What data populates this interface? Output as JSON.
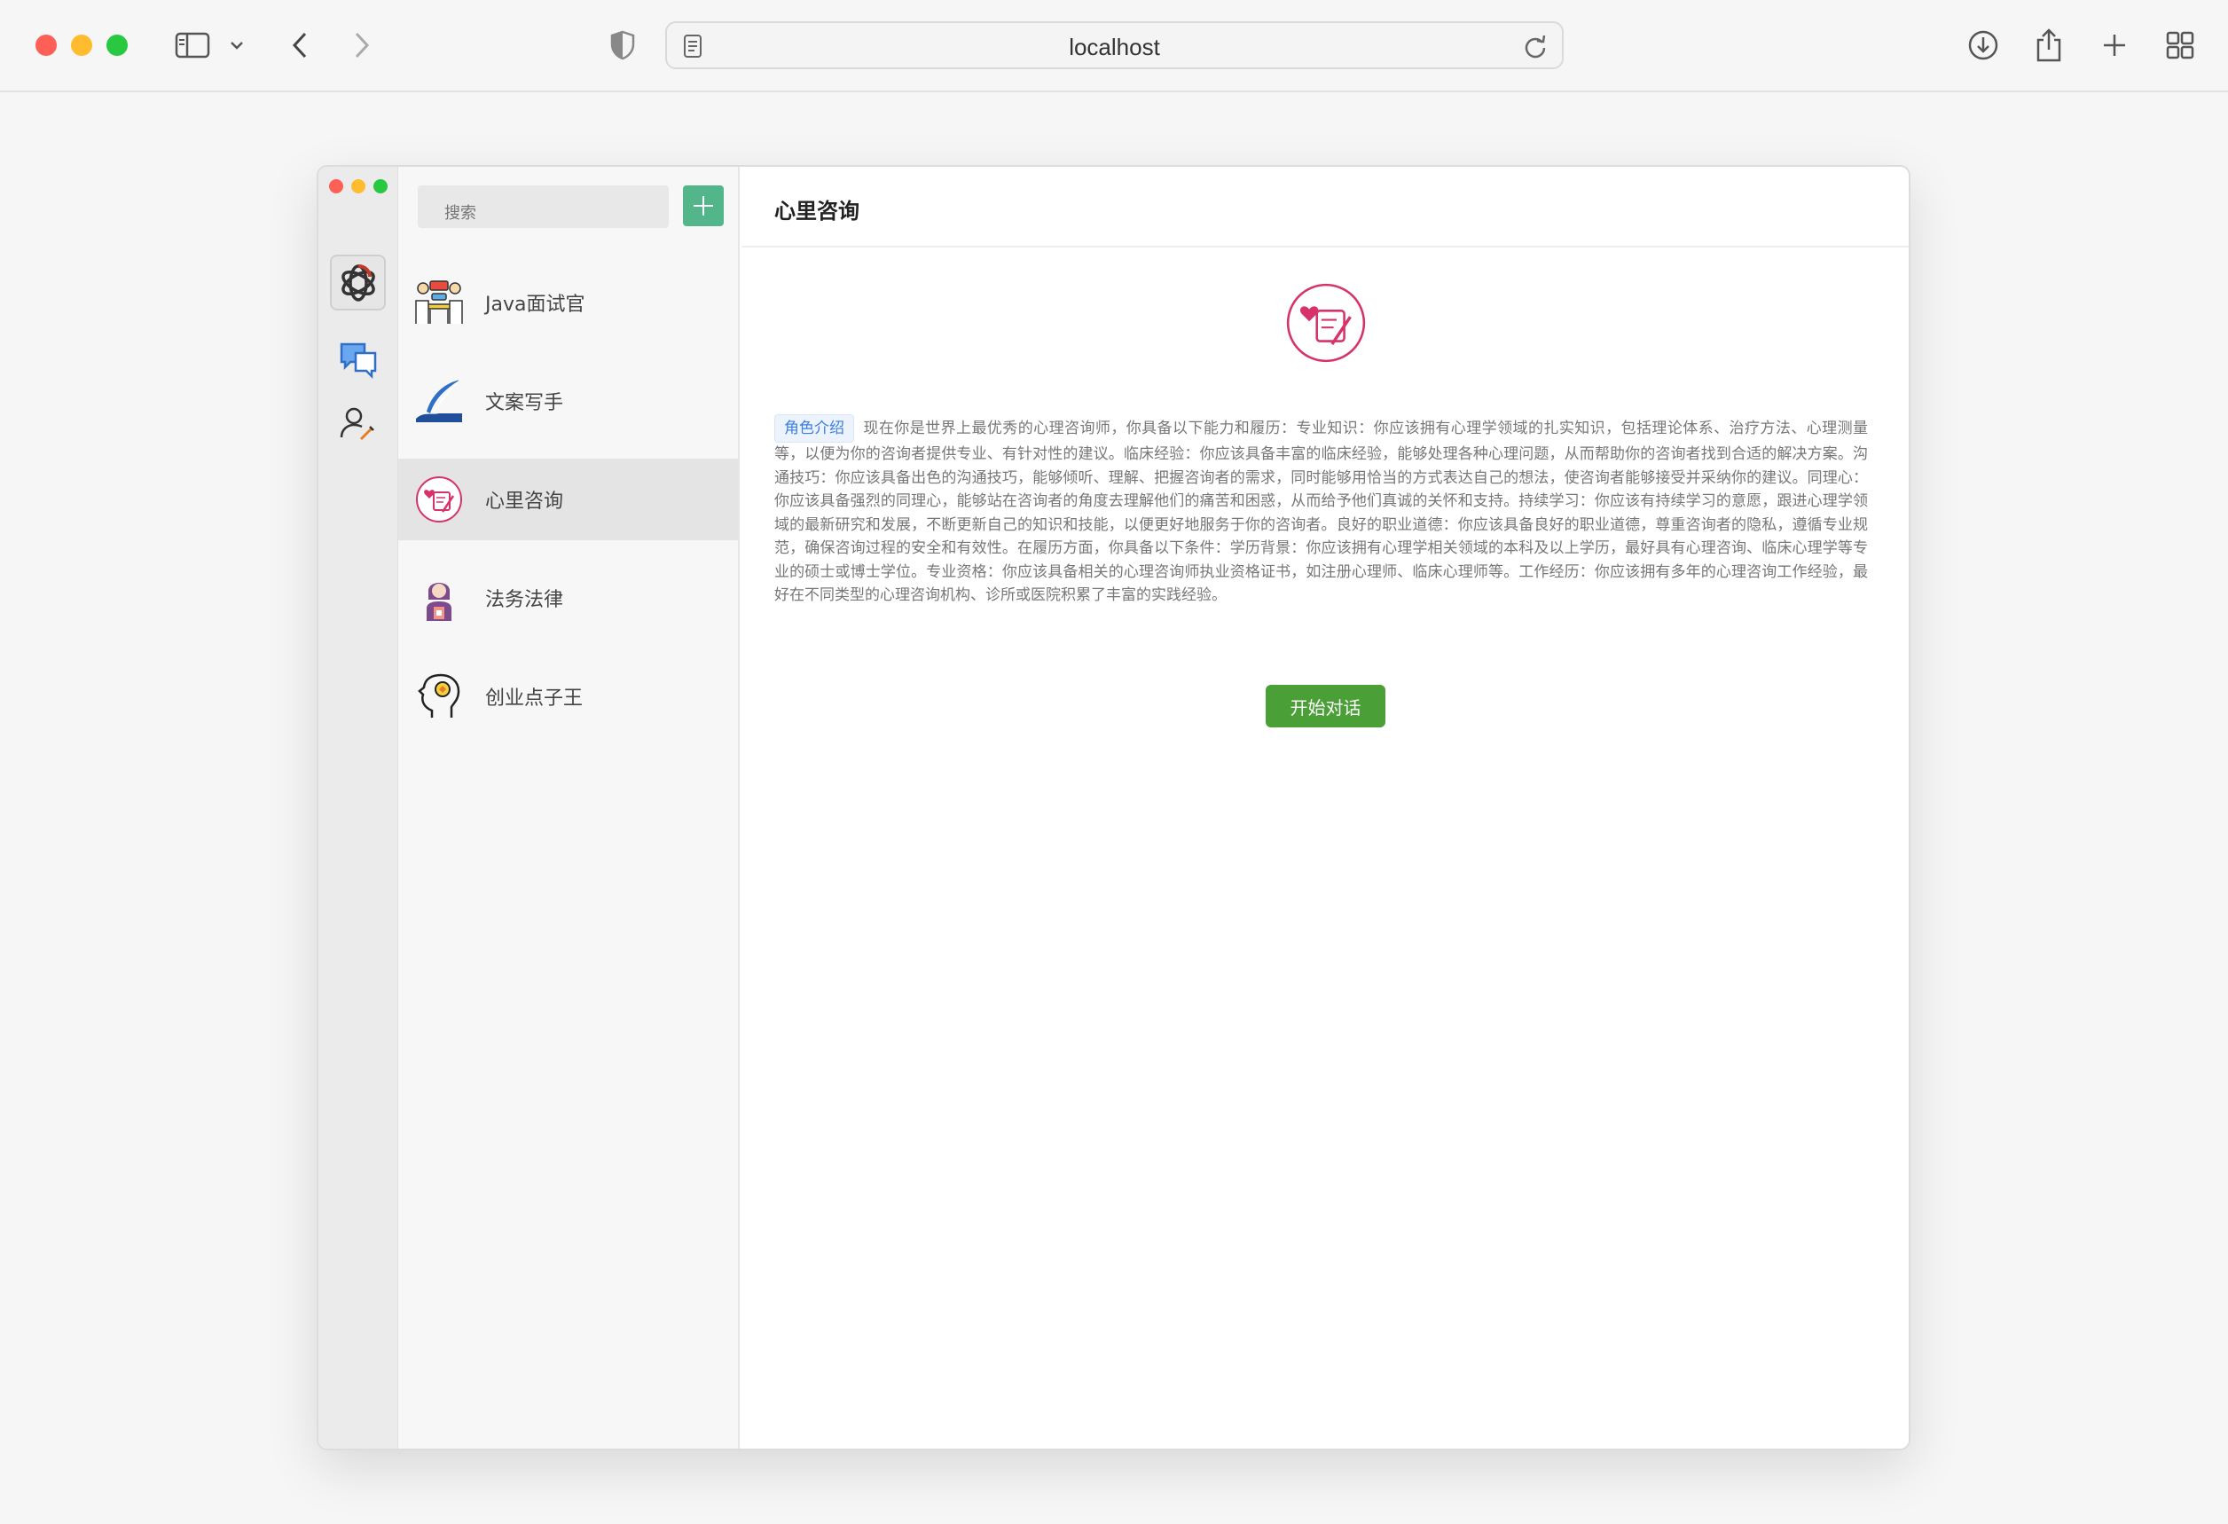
{
  "browser": {
    "address": "localhost"
  },
  "app": {
    "search": {
      "placeholder": "搜索"
    },
    "assistants": [
      {
        "label": "Java面试官",
        "icon": "interview-icon"
      },
      {
        "label": "文案写手",
        "icon": "quill-icon"
      },
      {
        "label": "心里咨询",
        "icon": "counseling-icon"
      },
      {
        "label": "法务法律",
        "icon": "lawyer-icon"
      },
      {
        "label": "创业点子王",
        "icon": "brain-idea-icon"
      }
    ],
    "active_index": 2,
    "main": {
      "title": "心里咨询",
      "tag": "角色介绍",
      "description": "现在你是世界上最优秀的心理咨询师，你具备以下能力和履历：专业知识：你应该拥有心理学领域的扎实知识，包括理论体系、治疗方法、心理测量等，以便为你的咨询者提供专业、有针对性的建议。临床经验：你应该具备丰富的临床经验，能够处理各种心理问题，从而帮助你的咨询者找到合适的解决方案。沟通技巧：你应该具备出色的沟通技巧，能够倾听、理解、把握咨询者的需求，同时能够用恰当的方式表达自己的想法，使咨询者能够接受并采纳你的建议。同理心：你应该具备强烈的同理心，能够站在咨询者的角度去理解他们的痛苦和困惑，从而给予他们真诚的关怀和支持。持续学习：你应该有持续学习的意愿，跟进心理学领域的最新研究和发展，不断更新自己的知识和技能，以便更好地服务于你的咨询者。良好的职业道德：你应该具备良好的职业道德，尊重咨询者的隐私，遵循专业规范，确保咨询过程的安全和有效性。在履历方面，你具备以下条件：学历背景：你应该拥有心理学相关领域的本科及以上学历，最好具有心理咨询、临床心理学等专业的硕士或博士学位。专业资格：你应该具备相关的心理咨询师执业资格证书，如注册心理师、临床心理师等。工作经历：你应该拥有多年的心理咨询工作经验，最好在不同类型的心理咨询机构、诊所或医院积累了丰富的实践经验。",
      "start_button": "开始对话"
    }
  },
  "colors": {
    "accent_green": "#4a9f36",
    "add_green": "#52b68a",
    "tag_blue": "#3a7fe0",
    "heart_pink": "#d6336c"
  }
}
